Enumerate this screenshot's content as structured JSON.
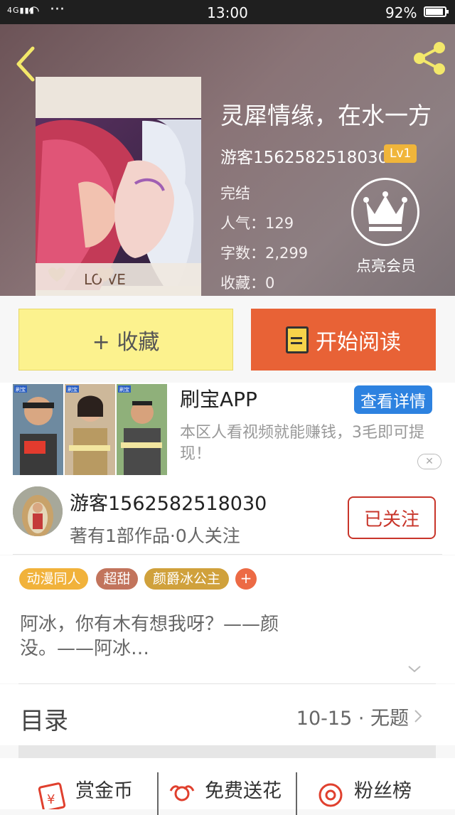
{
  "status_bar": {
    "network": "4G",
    "time": "13:00",
    "battery": "92%"
  },
  "book": {
    "title": "灵犀情缘，在水一方",
    "author": "游客1562582518030",
    "level": "Lv1",
    "status": "完结",
    "popularity": "人气：129",
    "words": "字数：2,299",
    "favorites": "收藏：0",
    "cover_text": "LO VE",
    "vip_label": "点亮会员"
  },
  "actions": {
    "favorite_label": "+ 收藏",
    "read_label": "开始阅读"
  },
  "ad": {
    "title": "刷宝APP",
    "cta": "查看详情",
    "description": "本区人看视频就能赚钱，3毛即可提现！",
    "thumb_badge": "刷宝",
    "close_icon": "close-icon"
  },
  "author_card": {
    "name": "游客1562582518030",
    "subtitle": "著有1部作品·0人关注",
    "follow_label": "已关注"
  },
  "tags": [
    {
      "label": "动漫同人",
      "color": "#f1b23b"
    },
    {
      "label": "超甜",
      "color": "#c2745c"
    },
    {
      "label": "颜爵冰公主",
      "color": "#d0a13c"
    }
  ],
  "tag_add": "+",
  "description": "阿冰，你有木有想我呀？——颜没。——阿冰…",
  "catalog": {
    "label": "目录",
    "latest": "10-15 · 无题"
  },
  "bottom_bar": {
    "items": [
      {
        "label": "赏金币",
        "icon": "coin-reward-icon"
      },
      {
        "label": "免费送花",
        "icon": "flower-icon"
      },
      {
        "label": "粉丝榜",
        "icon": "fan-ranking-icon"
      }
    ]
  },
  "colors": {
    "accent_orange": "#e86236",
    "favorite_yellow": "#fcf28e",
    "follow_red": "#c8352a",
    "ad_blue": "#2d82e0",
    "level_badge": "#f0b53a"
  }
}
